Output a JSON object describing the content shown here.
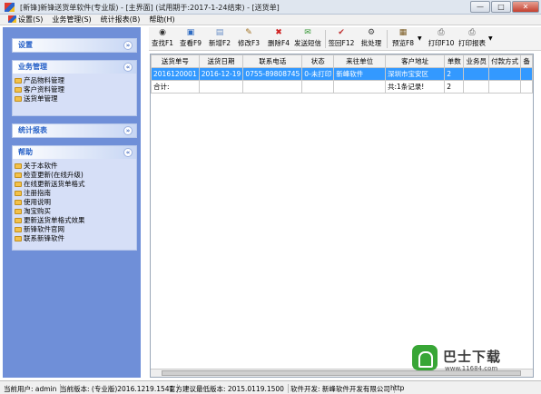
{
  "window": {
    "title": "[新锋]新锋送货单软件(专业版) - [主界面] (试用期于:2017-1-24结束) - [送货单]",
    "minimize": "—",
    "maximize": "□",
    "close": "✕"
  },
  "menu": [
    "设置(S)",
    "业务管理(S)",
    "统计报表(B)",
    "帮助(H)"
  ],
  "sidebar": {
    "settings": {
      "title": "设置",
      "chevron": "»"
    },
    "business": {
      "title": "业务管理",
      "chevron": "«",
      "items": [
        "产品物料管理",
        "客户资料管理",
        "送货单管理"
      ]
    },
    "reports": {
      "title": "统计报表",
      "chevron": "»"
    },
    "help": {
      "title": "帮助",
      "chevron": "«",
      "items": [
        "关于本软件",
        "检查更新(在线升级)",
        "在线更新送货单格式",
        "注册指南",
        "使用说明",
        "淘宝购买",
        "更新送货单格式效果",
        "新锋软件官网",
        "联系新锋软件"
      ]
    }
  },
  "toolbar": {
    "find": "查找F1",
    "view": "查看F9",
    "add": "新增F2",
    "edit": "修改F3",
    "delete": "删除F4",
    "sms": "发送短信",
    "sign": "签回F12",
    "batch": "批处理",
    "preview": "预览F8",
    "print": "打印F10",
    "report": "打印报表"
  },
  "grid": {
    "headers": [
      "送货单号",
      "送货日期",
      "联系电话",
      "状态",
      "来往单位",
      "客户地址",
      "单数",
      "业务员",
      "付款方式",
      "备"
    ],
    "rows": [
      [
        "2016120001",
        "2016-12-19",
        "0755-89808745",
        "0-未打印",
        "新峰软件",
        "深圳市宝安区",
        "2",
        "",
        "",
        ""
      ]
    ],
    "total_label": "合计:",
    "total_count": "共:1条记录!",
    "total_sum": "2"
  },
  "status": {
    "user": "当前用户: admin",
    "version": "当前版本: (专业版)2016.1219.1541",
    "latest": "官方建议最低版本: 2015.0119.1500",
    "dev": "软件开发: 新峰软件开发有限公司",
    "http": "http"
  },
  "watermark": {
    "brand": "巴士下载",
    "url": "www.11684.com"
  }
}
